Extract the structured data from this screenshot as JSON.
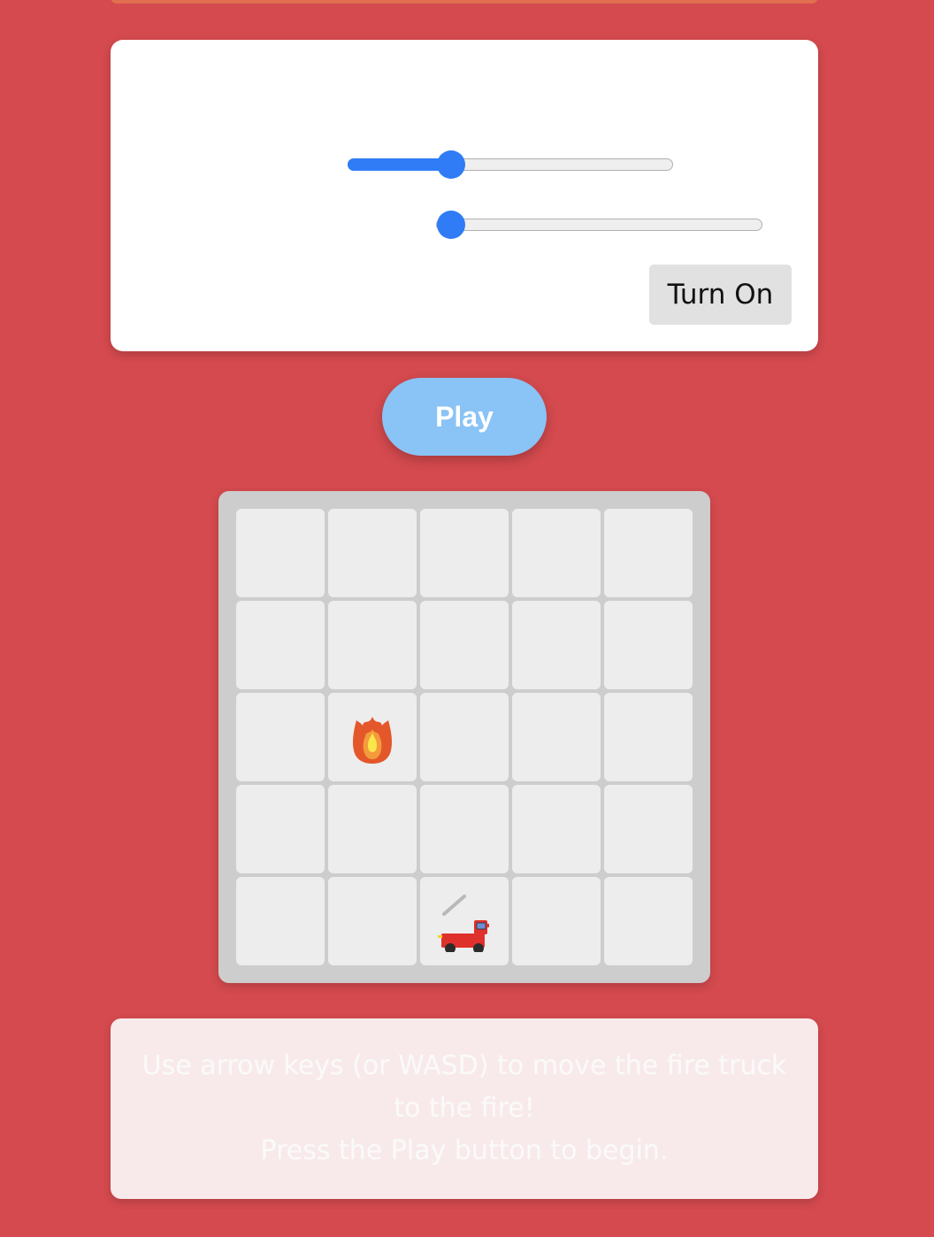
{
  "controls": {
    "slider_1": {
      "value_fraction": 0.3
    },
    "slider_2": {
      "value_fraction": 0.0
    },
    "turn_on_label": "Turn On"
  },
  "play_label": "Play",
  "board": {
    "rows": 5,
    "cols": 5,
    "fire": {
      "row": 2,
      "col": 1,
      "icon": "fire-icon"
    },
    "truck": {
      "row": 4,
      "col": 2,
      "icon": "fire-truck-icon"
    }
  },
  "instructions": {
    "line1": "Use arrow keys (or WASD) to move the fire truck",
    "line2": "to the fire!",
    "line3": "Press the Play button to begin."
  },
  "colors": {
    "background": "#d44a4e",
    "accent": "#2f7cf6",
    "play_button": "#8ac3f5"
  }
}
